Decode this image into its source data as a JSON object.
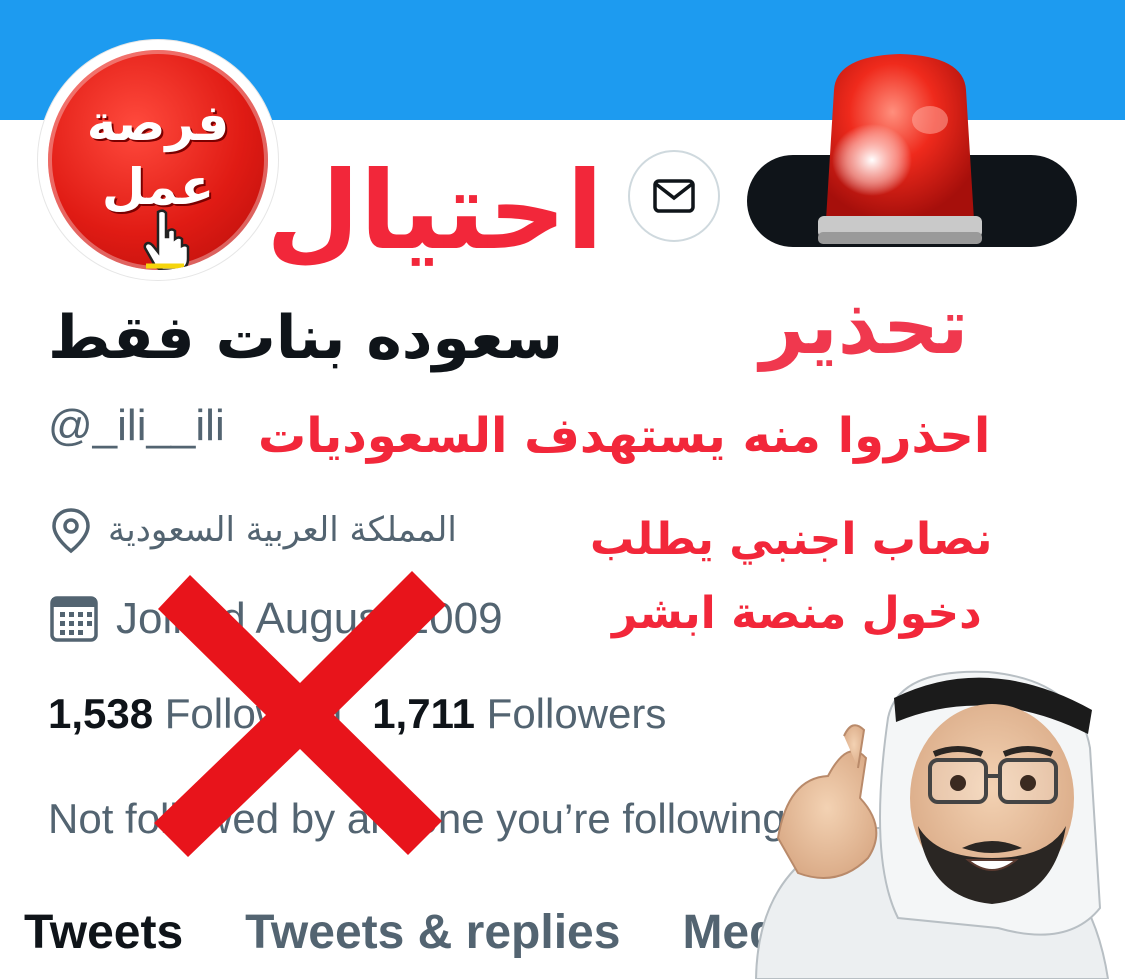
{
  "profile": {
    "display_name": "سعوده بنات فقط",
    "handle": "@_ili__ili",
    "location": "المملكة العربية السعودية",
    "joined": "Joined August 2009",
    "following_count": "1,538",
    "following_label": "Following",
    "followers_count": "1,711",
    "followers_label": "Followers",
    "not_followed_text": "Not followed by anyone you’re following"
  },
  "avatar": {
    "line1": "فرصة",
    "line2": "عمل"
  },
  "tabs": [
    {
      "label": "Tweets",
      "active": true
    },
    {
      "label": "Tweets & replies",
      "active": false
    },
    {
      "label": "Media",
      "active": false
    }
  ],
  "overlay": {
    "scam_word": "احتيال",
    "warning_word": "تحذير",
    "line1": "احذروا منه يستهدف السعوديات",
    "line2": "نصاب اجنبي يطلب",
    "line3": "دخول منصة ابشر"
  },
  "colors": {
    "banner": "#1d9bf0",
    "warning_red": "#f2273a",
    "text_primary": "#0f1419",
    "text_secondary": "#536471"
  },
  "icons": [
    "mail-icon",
    "location-pin-icon",
    "calendar-icon",
    "siren-icon",
    "pointing-hand-icon",
    "red-x-mark",
    "man-emoji-sticker"
  ]
}
